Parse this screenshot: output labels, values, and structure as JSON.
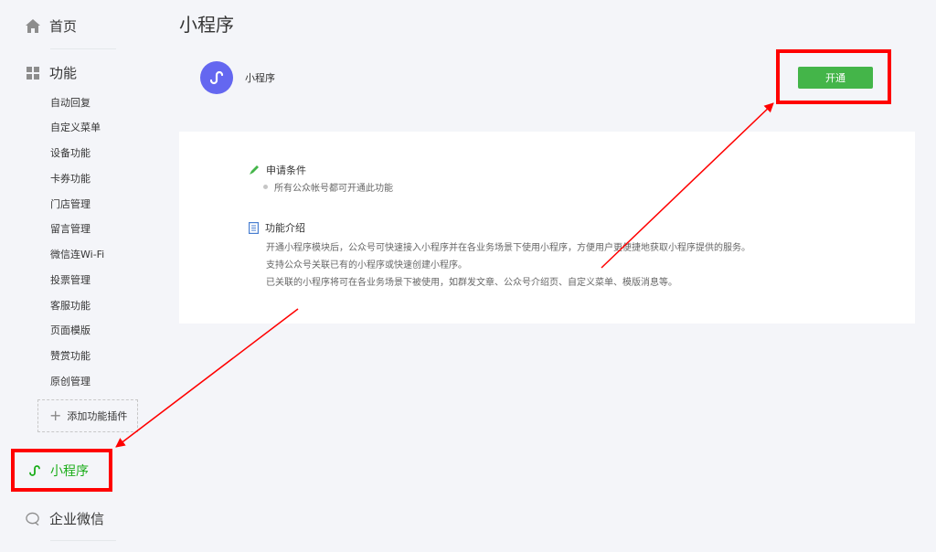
{
  "sidebar": {
    "home_label": "首页",
    "features_label": "功能",
    "items": [
      {
        "label": "自动回复"
      },
      {
        "label": "自定义菜单"
      },
      {
        "label": "设备功能"
      },
      {
        "label": "卡券功能"
      },
      {
        "label": "门店管理"
      },
      {
        "label": "留言管理"
      },
      {
        "label": "微信连Wi-Fi"
      },
      {
        "label": "投票管理"
      },
      {
        "label": "客服功能"
      },
      {
        "label": "页面模版"
      },
      {
        "label": "赞赏功能"
      },
      {
        "label": "原创管理"
      }
    ],
    "add_plugin_label": "添加功能插件",
    "mini_program_label": "小程序",
    "enterprise_label": "企业微信"
  },
  "main": {
    "title": "小程序",
    "app_name": "小程序",
    "open_button_label": "开通",
    "conditions": {
      "title": "申请条件",
      "item": "所有公众帐号都可开通此功能"
    },
    "intro": {
      "title": "功能介绍",
      "lines": [
        "开通小程序模块后，公众号可快速接入小程序并在各业务场景下使用小程序，方便用户更便捷地获取小程序提供的服务。",
        "支持公众号关联已有的小程序或快速创建小程序。",
        "已关联的小程序将可在各业务场景下被使用，如群发文章、公众号介绍页、自定义菜单、模版消息等。"
      ]
    }
  },
  "colors": {
    "accent_green": "#44b549",
    "active_green": "#1aad19",
    "annotation_red": "#ff0000",
    "logo_purple": "#6467f0"
  }
}
